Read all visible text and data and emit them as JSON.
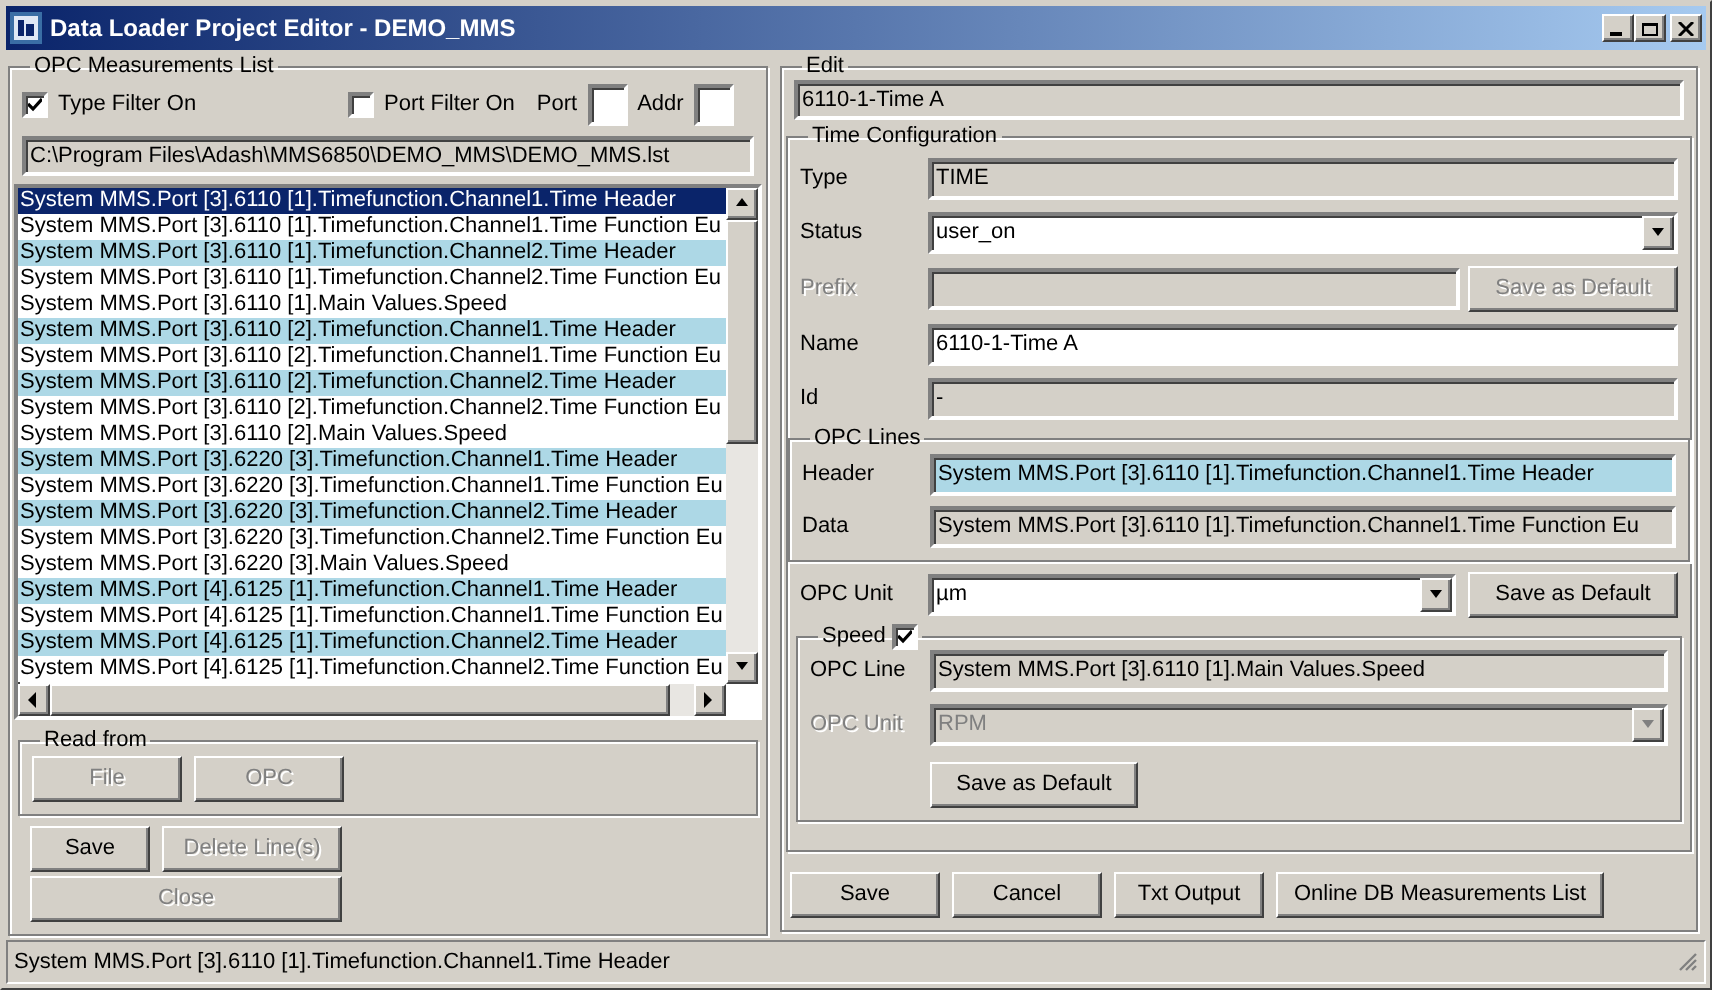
{
  "window": {
    "title": "Data Loader Project Editor - DEMO_MMS"
  },
  "measurements": {
    "title": "OPC Measurements List",
    "type_filter": {
      "label": "Type Filter On",
      "checked": true
    },
    "port_filter": {
      "label": "Port Filter On",
      "checked": false
    },
    "port_label": "Port",
    "addr_label": "Addr",
    "path": "C:\\Program Files\\Adash\\MMS6850\\DEMO_MMS\\DEMO_MMS.lst",
    "rows": [
      {
        "text": "System MMS.Port [3].6110 [1].Timefunction.Channel1.Time Header",
        "selected": true
      },
      {
        "text": "System MMS.Port [3].6110 [1].Timefunction.Channel1.Time Function Eu",
        "selected": false,
        "highlighted": false
      },
      {
        "text": "System MMS.Port [3].6110 [1].Timefunction.Channel2.Time Header",
        "selected": false,
        "highlighted": true
      },
      {
        "text": "System MMS.Port [3].6110 [1].Timefunction.Channel2.Time Function Eu",
        "selected": false,
        "highlighted": false
      },
      {
        "text": "System MMS.Port [3].6110 [1].Main Values.Speed",
        "selected": false,
        "highlighted": false
      },
      {
        "text": "System MMS.Port [3].6110 [2].Timefunction.Channel1.Time Header",
        "selected": false,
        "highlighted": true
      },
      {
        "text": "System MMS.Port [3].6110 [2].Timefunction.Channel1.Time Function Eu",
        "selected": false,
        "highlighted": false
      },
      {
        "text": "System MMS.Port [3].6110 [2].Timefunction.Channel2.Time Header",
        "selected": false,
        "highlighted": true
      },
      {
        "text": "System MMS.Port [3].6110 [2].Timefunction.Channel2.Time Function Eu",
        "selected": false,
        "highlighted": false
      },
      {
        "text": "System MMS.Port [3].6110 [2].Main Values.Speed",
        "selected": false,
        "highlighted": false
      },
      {
        "text": "System MMS.Port [3].6220 [3].Timefunction.Channel1.Time Header",
        "selected": false,
        "highlighted": true
      },
      {
        "text": "System MMS.Port [3].6220 [3].Timefunction.Channel1.Time Function Eu",
        "selected": false,
        "highlighted": false
      },
      {
        "text": "System MMS.Port [3].6220 [3].Timefunction.Channel2.Time Header",
        "selected": false,
        "highlighted": true
      },
      {
        "text": "System MMS.Port [3].6220 [3].Timefunction.Channel2.Time Function Eu",
        "selected": false,
        "highlighted": false
      },
      {
        "text": "System MMS.Port [3].6220 [3].Main Values.Speed",
        "selected": false,
        "highlighted": false
      },
      {
        "text": "System MMS.Port [4].6125 [1].Timefunction.Channel1.Time Header",
        "selected": false,
        "highlighted": true
      },
      {
        "text": "System MMS.Port [4].6125 [1].Timefunction.Channel1.Time Function Eu",
        "selected": false,
        "highlighted": false
      },
      {
        "text": "System MMS.Port [4].6125 [1].Timefunction.Channel2.Time Header",
        "selected": false,
        "highlighted": true
      },
      {
        "text": "System MMS.Port [4].6125 [1].Timefunction.Channel2.Time Function Eu",
        "selected": false,
        "highlighted": false
      }
    ]
  },
  "read_from": {
    "title": "Read from",
    "buttons": [
      {
        "label": "File",
        "disabled": true
      },
      {
        "label": "OPC",
        "disabled": true
      }
    ]
  },
  "actions": [
    {
      "label": "Save",
      "disabled": false
    },
    {
      "label": "Delete Line(s)",
      "disabled": true
    },
    {
      "label": "Close",
      "disabled": true
    }
  ],
  "edit": {
    "title": "Edit",
    "value": "6110-1-Time A",
    "time_config": {
      "title": "Time Configuration",
      "fields": [
        {
          "label": "Type",
          "kind": "readonly",
          "value": "TIME",
          "disabled": false
        },
        {
          "label": "Status",
          "kind": "dropdown",
          "value": "user_on",
          "disabled": false
        },
        {
          "label": "Prefix",
          "kind": "readonly",
          "disabled": true,
          "button": {
            "label": "Save as Default",
            "disabled": true
          }
        },
        {
          "label": "Name",
          "kind": "input",
          "value": "6110-1-Time A",
          "disabled": false
        },
        {
          "label": "Id",
          "kind": "readonly",
          "value": "-",
          "disabled": false
        }
      ]
    },
    "opc_lines": {
      "title": "OPC Lines",
      "fields": [
        {
          "label": "Header",
          "value": "System MMS.Port [3].6110 [1].Timefunction.Channel1.Time Header",
          "highlighted": true
        },
        {
          "label": "Data",
          "value": "System MMS.Port [3].6110 [1].Timefunction.Channel1.Time Function Eu",
          "highlighted": false
        }
      ]
    },
    "opc_unit": {
      "label": "OPC Unit",
      "value": "µm",
      "disabled": false,
      "button": {
        "label": "Save as Default",
        "disabled": false
      }
    },
    "speed": {
      "title": "Speed",
      "checked": true,
      "opc_line": {
        "label": "OPC Line",
        "value": "System MMS.Port [3].6110 [1].Main Values.Speed"
      },
      "opc_unit": {
        "label": "OPC Unit",
        "value": "RPM",
        "disabled": true
      },
      "button": {
        "label": "Save as Default",
        "disabled": false
      }
    }
  },
  "bottom_buttons": [
    {
      "label": "Save"
    },
    {
      "label": "Cancel"
    },
    {
      "label": "Txt Output"
    },
    {
      "label": "Online DB Measurements List"
    }
  ],
  "status_bar": {
    "text": "System MMS.Port [3].6110 [1].Timefunction.Channel1.Time Header"
  }
}
